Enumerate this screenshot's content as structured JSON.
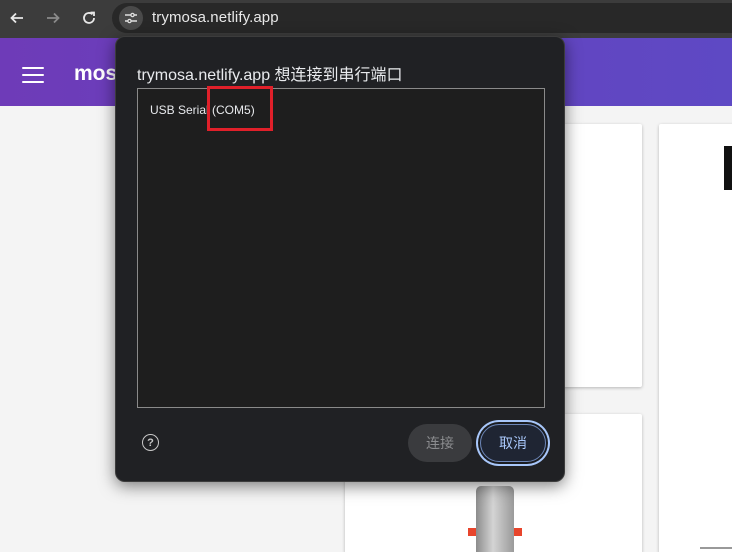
{
  "browser": {
    "url": "trymosa.netlify.app",
    "back_icon": "arrow-left-icon",
    "forward_icon": "arrow-right-icon",
    "reload_icon": "reload-icon",
    "site_info_icon": "tune-icon"
  },
  "page": {
    "app_title": "mos",
    "accent_color": "#6a3cb8"
  },
  "dialog": {
    "title": "trymosa.netlify.app 想连接到串行端口",
    "ports": [
      "USB Serial (COM5)"
    ],
    "connect_label": "连接",
    "cancel_label": "取消",
    "help_icon": "help-icon"
  },
  "annotation": {
    "color": "#e0202a"
  }
}
